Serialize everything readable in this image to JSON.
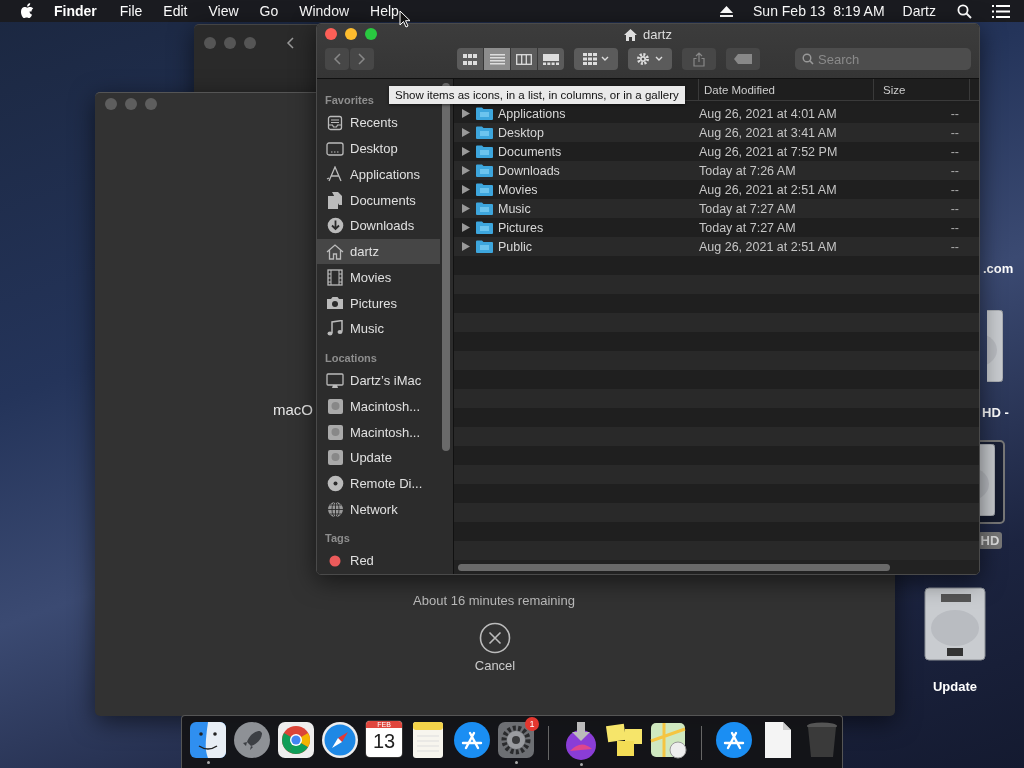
{
  "menubar": {
    "app": "Finder",
    "menus": [
      "File",
      "Edit",
      "View",
      "Go",
      "Window",
      "Help"
    ],
    "clock": "Sun Feb 13  8:19 AM",
    "user": "Dartz"
  },
  "installer": {
    "title_text": "macO",
    "status": "About 16 minutes remaining",
    "cancel": "Cancel"
  },
  "finder": {
    "title": "dartz",
    "search": {
      "placeholder": "Search"
    },
    "view_modes": [
      {
        "kind": "icons",
        "selected": false
      },
      {
        "kind": "list",
        "selected": true
      },
      {
        "kind": "columns",
        "selected": false
      },
      {
        "kind": "gallery",
        "selected": false
      }
    ],
    "tooltip": "Show items as icons, in a list, in columns, or in a gallery",
    "sidebar": [
      {
        "heading": "Favorites",
        "items": [
          {
            "label": "Recents",
            "kind": "recents",
            "selected": false
          },
          {
            "label": "Desktop",
            "kind": "desktop",
            "selected": false
          },
          {
            "label": "Applications",
            "kind": "apps",
            "selected": false
          },
          {
            "label": "Documents",
            "kind": "docs",
            "selected": false
          },
          {
            "label": "Downloads",
            "kind": "downloads",
            "selected": false
          },
          {
            "label": "dartz",
            "kind": "home",
            "selected": true
          },
          {
            "label": "Movies",
            "kind": "movies",
            "selected": false
          },
          {
            "label": "Pictures",
            "kind": "pictures",
            "selected": false
          },
          {
            "label": "Music",
            "kind": "music",
            "selected": false
          }
        ]
      },
      {
        "heading": "Locations",
        "items": [
          {
            "label": "Dartz’s iMac",
            "kind": "computer",
            "selected": false
          },
          {
            "label": "Macintosh...",
            "kind": "disk",
            "selected": false
          },
          {
            "label": "Macintosh...",
            "kind": "disk",
            "selected": false
          },
          {
            "label": "Update",
            "kind": "disk",
            "selected": false
          },
          {
            "label": "Remote Di...",
            "kind": "disc",
            "selected": false
          },
          {
            "label": "Network",
            "kind": "network",
            "selected": false
          }
        ]
      },
      {
        "heading": "Tags",
        "items": [
          {
            "label": "Red",
            "kind": "tag",
            "color": "#ec5b5b",
            "selected": false
          }
        ]
      }
    ],
    "columns": [
      "Date Modified",
      "Size"
    ],
    "rows": [
      {
        "name": "Applications",
        "date": "Aug 26, 2021 at 4:01 AM",
        "size": "--"
      },
      {
        "name": "Desktop",
        "date": "Aug 26, 2021 at 3:41 AM",
        "size": "--"
      },
      {
        "name": "Documents",
        "date": "Aug 26, 2021 at 7:52 PM",
        "size": "--"
      },
      {
        "name": "Downloads",
        "date": "Today at 7:26 AM",
        "size": "--"
      },
      {
        "name": "Movies",
        "date": "Aug 26, 2021 at 2:51 AM",
        "size": "--"
      },
      {
        "name": "Music",
        "date": "Today at 7:27 AM",
        "size": "--"
      },
      {
        "name": "Pictures",
        "date": "Today at 7:27 AM",
        "size": "--"
      },
      {
        "name": "Public",
        "date": "Aug 26, 2021 at 2:51 AM",
        "size": "--"
      }
    ]
  },
  "desktop_icons": [
    {
      "label": ".com",
      "kind": "text",
      "selected": false
    },
    {
      "label": "HD -",
      "kind": "disk",
      "selected": false
    },
    {
      "label": "HD",
      "kind": "disk",
      "selected": true
    },
    {
      "label": "Update",
      "kind": "disk",
      "selected": false
    }
  ],
  "dock": [
    {
      "kind": "finder",
      "running": true
    },
    {
      "kind": "launchpad",
      "running": false
    },
    {
      "kind": "chrome",
      "running": false
    },
    {
      "kind": "safari",
      "running": false
    },
    {
      "kind": "calendar",
      "running": false,
      "month": "FEB",
      "day": "13"
    },
    {
      "kind": "notes",
      "running": false
    },
    {
      "kind": "appstore",
      "running": false
    },
    {
      "kind": "settings",
      "running": true,
      "badge": "1"
    },
    {
      "kind": "separator"
    },
    {
      "kind": "installer",
      "running": true
    },
    {
      "kind": "stickies",
      "running": false
    },
    {
      "kind": "maps",
      "running": false
    },
    {
      "kind": "separator"
    },
    {
      "kind": "appstore",
      "running": false
    },
    {
      "kind": "document",
      "running": false
    },
    {
      "kind": "trash",
      "running": false
    }
  ]
}
